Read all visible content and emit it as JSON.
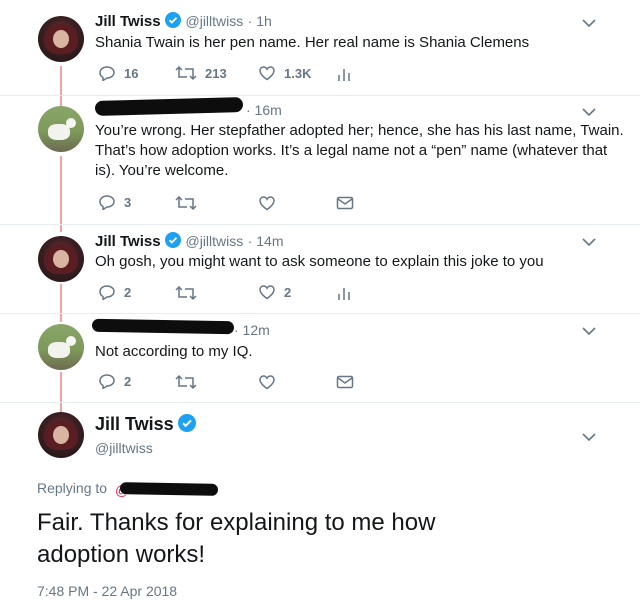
{
  "tweets": [
    {
      "name": "Jill Twiss",
      "handle": "@jilltwiss",
      "time": "· 1h",
      "text": "Shania Twain is her pen name. Her real name is Shania Clemens",
      "replies": "16",
      "retweets": "213",
      "likes": "1.3K"
    },
    {
      "time": "· 16m",
      "text_lines": [
        "You’re wrong. Her stepfather adopted her; hence, she has his last name, Twain.",
        "That’s how adoption works. It’s a legal name not a “pen” name (whatever that",
        "is). You’re welcome."
      ],
      "replies": "3"
    },
    {
      "name": "Jill Twiss",
      "handle": "@jilltwiss",
      "time": "· 14m",
      "text": "Oh gosh, you might want to ask someone to explain this joke to you",
      "replies": "2",
      "likes": "2"
    },
    {
      "time": "· 12m",
      "text": "Not according to my IQ.",
      "replies": "2"
    }
  ],
  "main": {
    "name": "Jill Twiss",
    "handle": "@jilltwiss",
    "replying_to": "Replying to",
    "text_lines": [
      "Fair. Thanks for explaining to me how",
      "adoption works!"
    ],
    "timestamp": "7:48 PM - 22 Apr 2018"
  },
  "colors": {
    "thread_line": "#f4a3a3",
    "verified": "#1da1f2",
    "secondary_text": "#657786",
    "mention": "#e0245e"
  },
  "icons": [
    "reply-icon",
    "retweet-icon",
    "like-icon",
    "analytics-icon",
    "message-icon",
    "chevron-down-icon",
    "verified-badge-icon"
  ]
}
